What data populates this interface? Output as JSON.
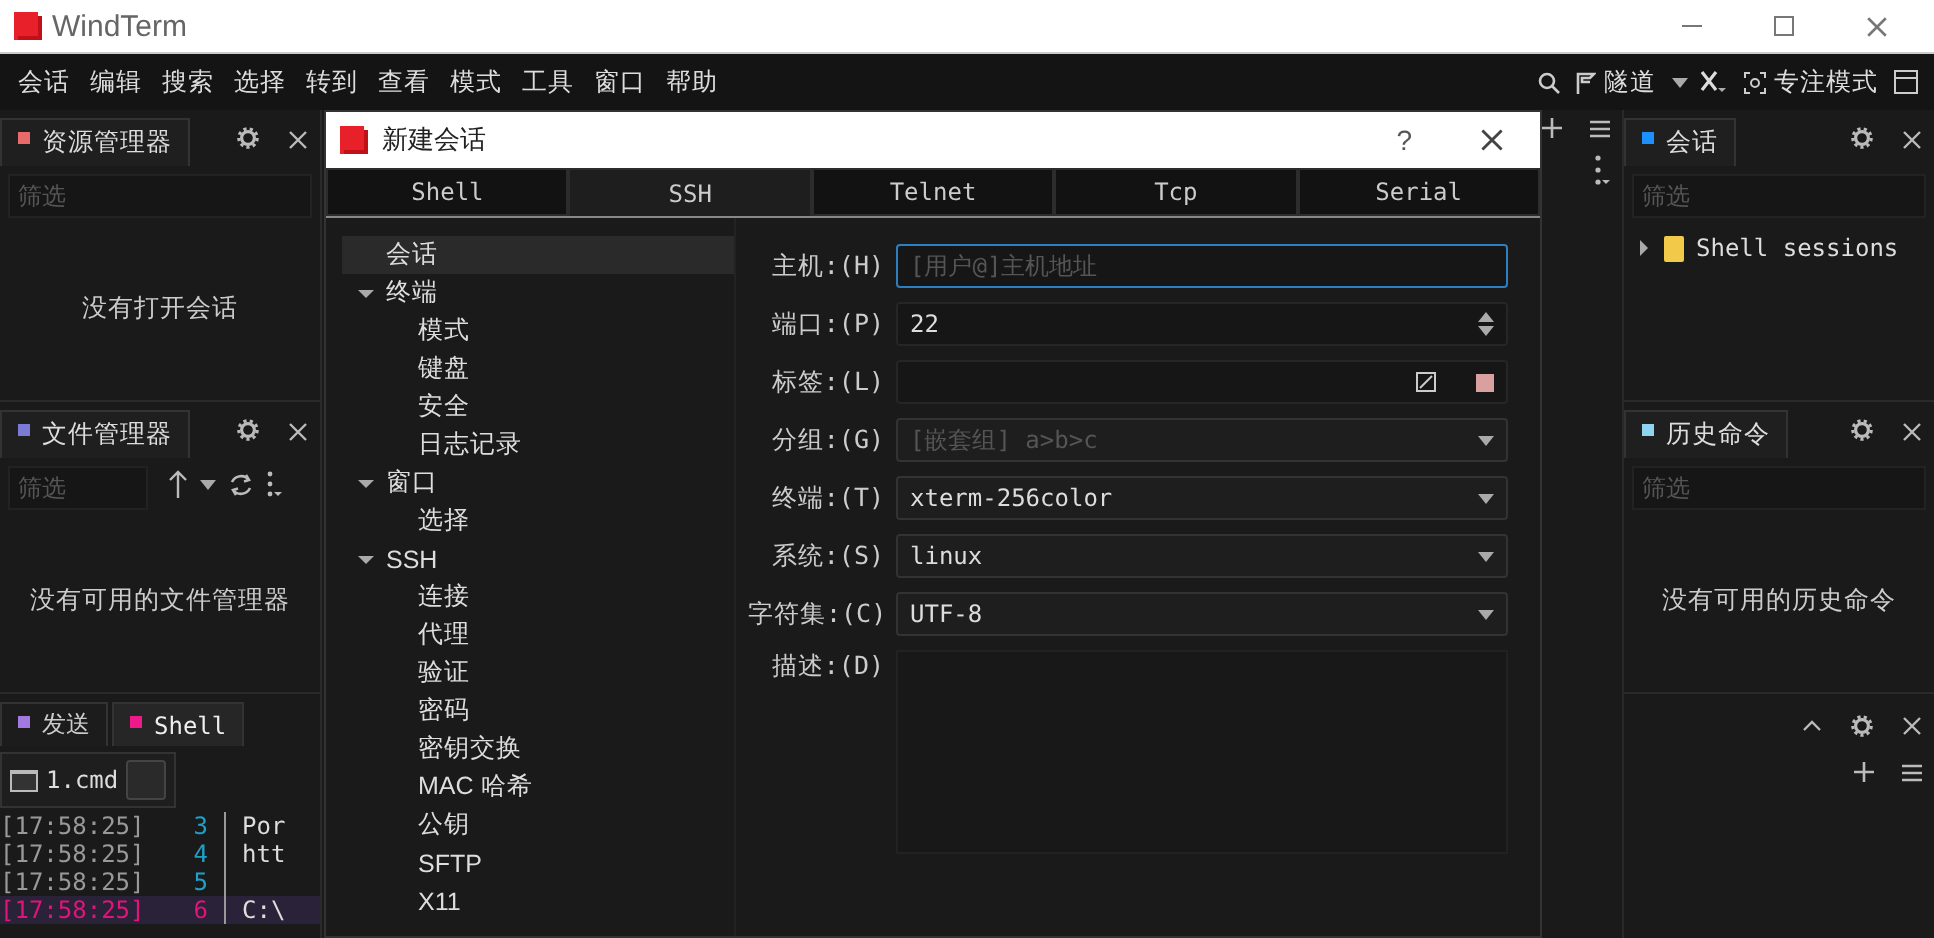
{
  "window": {
    "title": "WindTerm"
  },
  "menu_bar": {
    "items": [
      "会话",
      "编辑",
      "搜索",
      "选择",
      "转到",
      "查看",
      "模式",
      "工具",
      "窗口",
      "帮助"
    ],
    "tunnel_label": "隧道",
    "focus_label": "专注模式"
  },
  "left_panels": [
    {
      "kind": "explorer",
      "title": "资源管理器",
      "color": "#e86a6a",
      "filter_placeholder": "筛选",
      "empty_text": "没有打开会话"
    },
    {
      "kind": "files",
      "title": "文件管理器",
      "color": "#7b7bd6",
      "filter_placeholder": "筛选",
      "empty_text": "没有可用的文件管理器"
    }
  ],
  "bottom_panel": {
    "tabs": [
      {
        "label": "发送",
        "color": "#a07ae0",
        "selected": false
      },
      {
        "label": "Shell",
        "color": "#f0198a",
        "selected": true
      }
    ],
    "session_tab": {
      "label": "1.cmd"
    },
    "lines": [
      {
        "time": "[17:58:25]",
        "number": "3",
        "text": "Por",
        "selected": false
      },
      {
        "time": "[17:58:25]",
        "number": "4",
        "text": "htt",
        "selected": false
      },
      {
        "time": "[17:58:25]",
        "number": "5",
        "selected": false
      },
      {
        "time": "[17:58:25]",
        "number": "6",
        "text": "C:\\",
        "selected": true
      }
    ]
  },
  "right_panels": {
    "sessions": {
      "title": "会话",
      "color": "#1e8fff",
      "filter_placeholder": "筛选",
      "tree": [
        {
          "label": "Shell sessions",
          "expanded": false
        }
      ]
    },
    "history": {
      "title": "历史命令",
      "color": "#8fd3f0",
      "filter_placeholder": "筛选",
      "empty_text": "没有可用的历史命令"
    }
  },
  "dialog": {
    "title": "新建会话",
    "help": "?",
    "tabs": [
      {
        "label": "Shell",
        "selected": false
      },
      {
        "label": "SSH",
        "selected": true
      },
      {
        "label": "Telnet",
        "selected": false
      },
      {
        "label": "Tcp",
        "selected": false
      },
      {
        "label": "Serial",
        "selected": false
      }
    ],
    "tree": [
      {
        "label": "会话",
        "selected": true
      },
      {
        "label": "终端",
        "selected": false,
        "expanded": true,
        "children": [
          {
            "label": "模式",
            "selected": false
          },
          {
            "label": "键盘",
            "selected": false
          },
          {
            "label": "安全",
            "selected": false
          },
          {
            "label": "日志记录",
            "selected": false
          }
        ]
      },
      {
        "label": "窗口",
        "selected": false,
        "expanded": true,
        "children": [
          {
            "label": "选择",
            "selected": false
          }
        ]
      },
      {
        "label": "SSH",
        "selected": false,
        "expanded": true,
        "children": [
          {
            "label": "连接",
            "selected": false
          },
          {
            "label": "代理",
            "selected": false
          },
          {
            "label": "验证",
            "selected": false
          },
          {
            "label": "密码",
            "selected": false
          },
          {
            "label": "密钥交换",
            "selected": false
          },
          {
            "label": "MAC 哈希",
            "selected": false
          },
          {
            "label": "公钥",
            "selected": false
          },
          {
            "label": "SFTP",
            "selected": false
          },
          {
            "label": "X11",
            "selected": false
          }
        ]
      }
    ],
    "fields": [
      {
        "kind": "text",
        "label": "主机:(H)",
        "placeholder": "[用户@]主机地址",
        "focused": true
      },
      {
        "kind": "spin",
        "label": "端口:(P)",
        "value": "22",
        "focused": false
      },
      {
        "kind": "tag",
        "label": "标签:(L)",
        "focused": false
      },
      {
        "kind": "combo",
        "label": "分组:(G)",
        "placeholder": "[嵌套组] a>b>c",
        "focused": false
      },
      {
        "kind": "combo",
        "label": "终端:(T)",
        "value": "xterm-256color",
        "focused": false
      },
      {
        "kind": "combo",
        "label": "系统:(S)",
        "value": "linux",
        "focused": false
      },
      {
        "kind": "combo",
        "label": "字符集:(C)",
        "value": "UTF-8",
        "focused": false
      },
      {
        "kind": "textarea",
        "label": "描述:(D)",
        "focused": false
      }
    ]
  }
}
